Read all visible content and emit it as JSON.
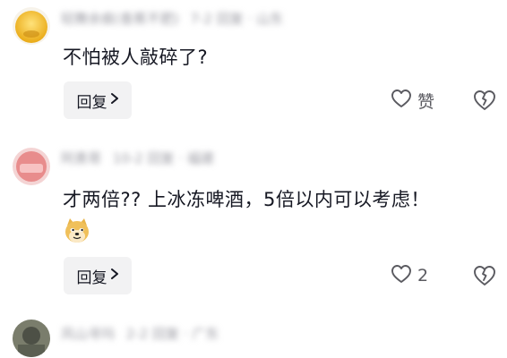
{
  "comments": [
    {
      "user": "轻舞余痕(香蕉不肥)",
      "meta": "7-2 回复 · 山东",
      "text": "不怕被人敲碎了?",
      "reply_label": "回复",
      "like_label": "赞",
      "avatar_color": "#f3c23a"
    },
    {
      "user": "阿勇哥",
      "meta": "10-2 回复 · 福建",
      "text": "才两倍?? 上冰冻啤酒，5倍以内可以考虑！",
      "reply_label": "回复",
      "like_label": "2",
      "avatar_color": "#e47a7a",
      "emoji": "doge-emoji"
    },
    {
      "user": "风山寻玛",
      "meta": "2-2 回复 · 广东",
      "avatar_color": "#6b6f5e"
    }
  ],
  "icons": {
    "reply_chevron": "chevron-right-icon",
    "like": "heart-outline-icon",
    "dislike": "broken-heart-icon"
  }
}
